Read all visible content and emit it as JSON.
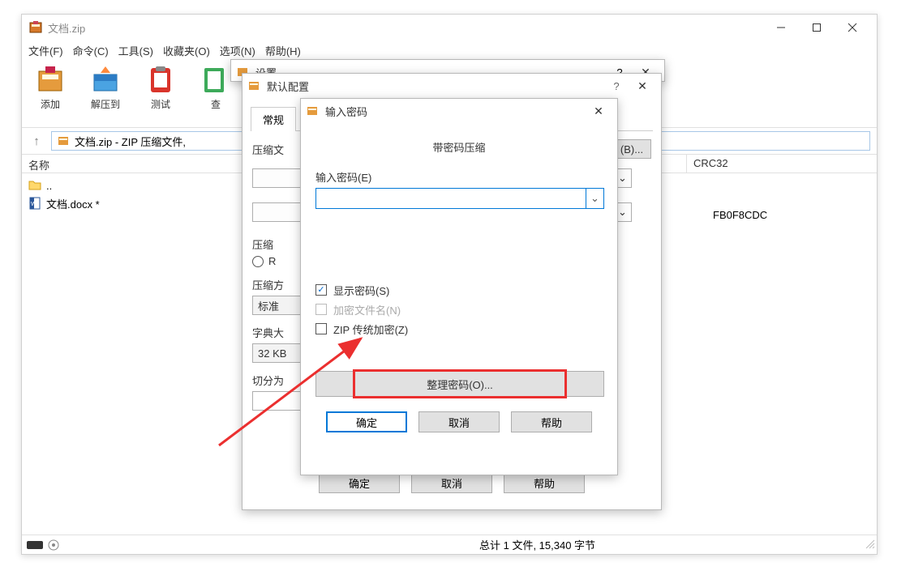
{
  "main": {
    "title": "文档.zip",
    "menus": [
      "文件(F)",
      "命令(C)",
      "工具(S)",
      "收藏夹(O)",
      "选项(N)",
      "帮助(H)"
    ],
    "tools": [
      "添加",
      "解压到",
      "测试",
      "查"
    ],
    "path": "文档.zip - ZIP 压缩文件,",
    "col_name": "名称",
    "col_crc": "CRC32",
    "files": {
      "up": "..",
      "item": "文档.docx *"
    },
    "crc": "FB0F8CDC",
    "status": "总计 1 文件, 15,340 字节"
  },
  "config": {
    "title": "默认配置",
    "help_q": "?",
    "tab": "常规",
    "field_compress": "压缩文",
    "browse": "(B)...",
    "field_format": "压缩",
    "radio_rar": "R",
    "field_method": "压缩方",
    "method_value": "标准",
    "field_dict": "字典大",
    "dict_value": "32 KB",
    "field_split": "切分为",
    "btn_ok": "确定",
    "btn_cancel": "取消",
    "btn_help": "帮助"
  },
  "password": {
    "title": "输入密码",
    "heading": "带密码压缩",
    "label_input": "输入密码(E)",
    "cb_show": "显示密码(S)",
    "cb_encrypt_name": "加密文件名(N)",
    "cb_zip_legacy": "ZIP 传统加密(Z)",
    "btn_organize": "整理密码(O)...",
    "btn_ok": "确定",
    "btn_cancel": "取消",
    "btn_help": "帮助"
  }
}
